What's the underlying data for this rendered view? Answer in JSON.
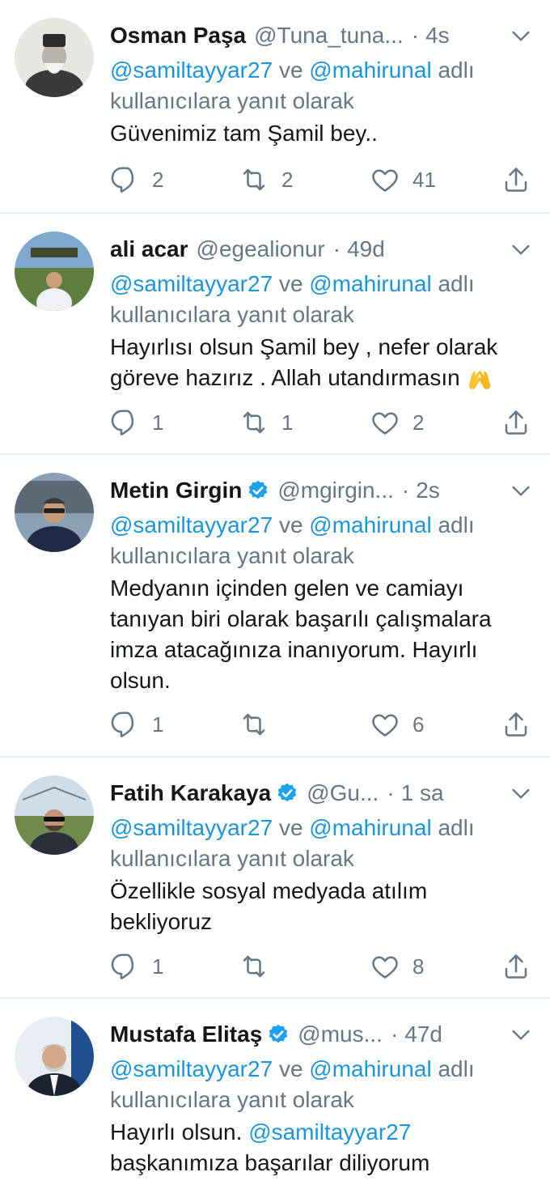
{
  "reply_prefix_joiner": "ve",
  "reply_suffix_line1": "adlı",
  "reply_suffix_line2": "kullanıcılara yanıt olarak",
  "mention_a": "@samiltayyar27",
  "mention_b": "@mahirunal",
  "colors": {
    "accent": "#1b95e0",
    "muted": "#657786",
    "text": "#14171a",
    "verified": "#1da1f2",
    "divider": "#e6ecf0"
  },
  "tweets": [
    {
      "name": "Osman Paşa",
      "handle": "@Tuna_tuna...",
      "dot": "·",
      "time": "4s",
      "verified": false,
      "text": "Güvenimiz tam Şamil bey..",
      "reply_count": "2",
      "retweet_count": "2",
      "like_count": "41"
    },
    {
      "name": "ali acar",
      "handle": "@egealionur",
      "dot": "·",
      "time": "49d",
      "verified": false,
      "text_line1": "Hayırlısı olsun Şamil bey , nefer olarak",
      "text_line2": "göreve hazırız . Allah utandırmasın",
      "emoji": "raising-hands-emoji",
      "reply_count": "1",
      "retweet_count": "1",
      "like_count": "2"
    },
    {
      "name": "Metin Girgin",
      "handle": "@mgirgin...",
      "dot": "·",
      "time": "2s",
      "verified": true,
      "text_lines": [
        "Medyanın içinden gelen ve camiayı",
        "tanıyan biri olarak başarılı çalışmalara",
        "imza atacağınıza inanıyorum. Hayırlı",
        "olsun."
      ],
      "reply_count": "1",
      "retweet_count": "",
      "like_count": "6"
    },
    {
      "name": "Fatih Karakaya",
      "handle": "@Gu...",
      "dot": "·",
      "time": "1 sa",
      "verified": true,
      "text_lines": [
        "Özellikle sosyal medyada atılım",
        "bekliyoruz"
      ],
      "reply_count": "1",
      "retweet_count": "",
      "like_count": "8"
    },
    {
      "name": "Mustafa Elitaş",
      "handle": "@mus...",
      "dot": "·",
      "time": "47d",
      "verified": true,
      "text_line1_prefix": "Hayırlı olsun.",
      "text_line1_mention": "@samiltayyar27",
      "text_line2": "başkanımıza başarılar diliyorum"
    }
  ]
}
